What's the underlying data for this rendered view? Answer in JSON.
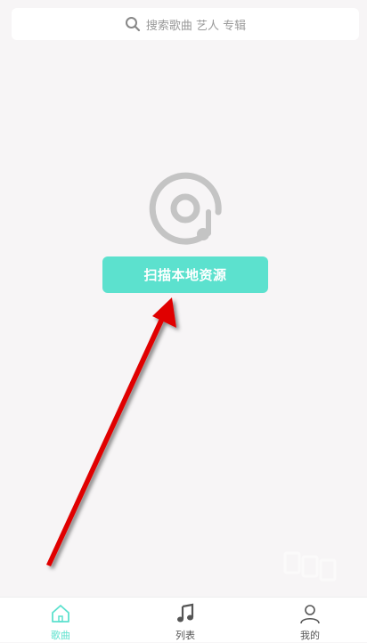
{
  "search": {
    "placeholder": "搜索歌曲 艺人 专辑",
    "icon": "search-icon"
  },
  "main": {
    "empty_icon": "music-disc-icon",
    "scan_button_label": "扫描本地资源"
  },
  "tabs": [
    {
      "label": "歌曲",
      "icon": "home-icon",
      "active": true
    },
    {
      "label": "列表",
      "icon": "music-note-icon",
      "active": false
    },
    {
      "label": "我的",
      "icon": "user-icon",
      "active": false
    }
  ],
  "colors": {
    "accent": "#5ce1ce",
    "background": "#f7f5f6",
    "icon_gray": "#c4c4c4",
    "annotation_arrow": "#e00000"
  }
}
